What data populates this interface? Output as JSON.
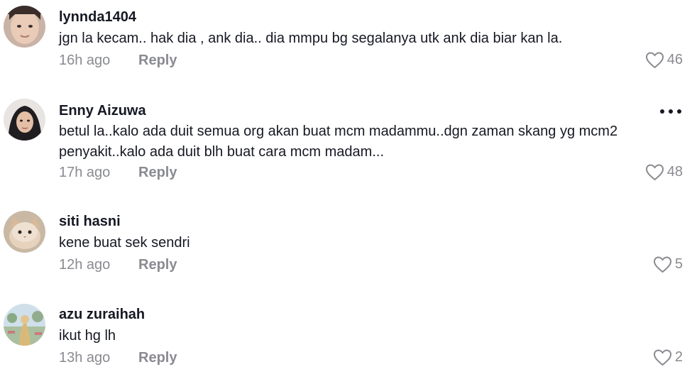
{
  "comments": [
    {
      "username": "lynnda1404",
      "text": "jgn la kecam.. hak dia , ank dia.. dia mmpu bg segalanya utk ank dia biar kan la.",
      "time": "16h ago",
      "reply_label": "Reply",
      "likes": "46"
    },
    {
      "username": "Enny Aizuwa",
      "text": "betul la..kalo ada duit semua org akan buat mcm madammu..dgn zaman skang yg mcm2 penyakit..kalo ada duit blh buat cara mcm madam...",
      "time": "17h ago",
      "reply_label": "Reply",
      "likes": "48"
    },
    {
      "username": "siti hasni",
      "text": "kene buat sek sendri",
      "time": "12h ago",
      "reply_label": "Reply",
      "likes": "5"
    },
    {
      "username": "azu zuraihah",
      "text": "ikut hg lh",
      "time": "13h ago",
      "reply_label": "Reply",
      "likes": "2"
    }
  ],
  "icons": {
    "like": "heart-outline-icon",
    "more": "more-options-icon"
  },
  "colors": {
    "primary_text": "#161823",
    "secondary_text": "#8a8b91"
  }
}
